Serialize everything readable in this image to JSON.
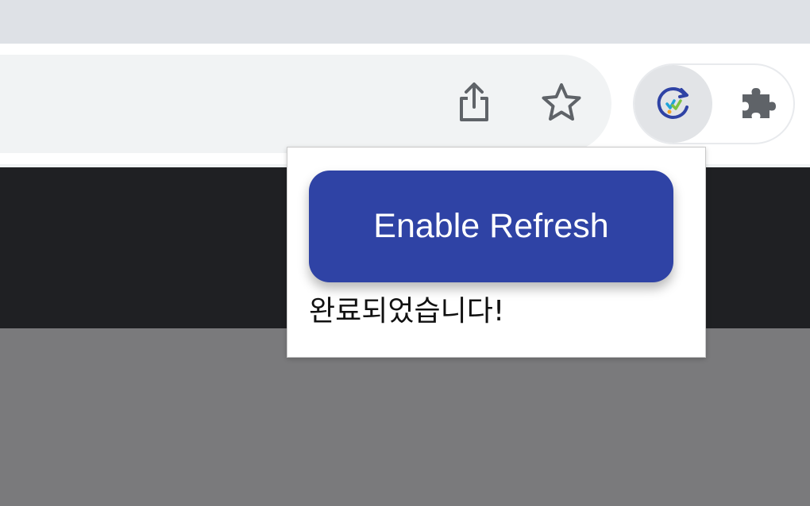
{
  "colors": {
    "tab_strip": "#dee1e6",
    "toolbar": "#ffffff",
    "omnibox": "#f1f3f4",
    "page_dark": "#1f2023",
    "page_grey": "#7a7a7c",
    "button_bg": "#2f43a5",
    "button_text": "#ffffff",
    "extension_accent": "#2f43a5"
  },
  "toolbar": {
    "icons": [
      "share-icon",
      "star-icon",
      "auto-refresh-extension-icon",
      "puzzle-icon"
    ]
  },
  "popup": {
    "button_label": "Enable Refresh",
    "status_text": "완료되었습니다!"
  }
}
